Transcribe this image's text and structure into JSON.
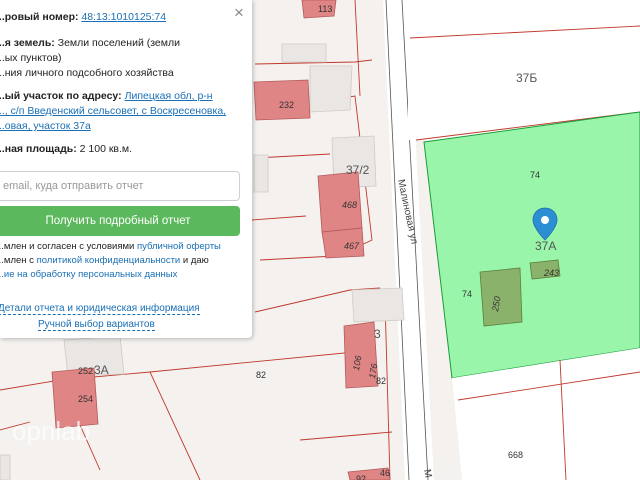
{
  "map": {
    "parcels": [
      "113",
      "232",
      "37/2",
      "468",
      "467",
      "37Б",
      "74",
      "74",
      "37А",
      "243",
      "74",
      "250",
      "106",
      "176",
      "82",
      "3",
      "82",
      "252",
      "254",
      "3А",
      "668",
      "46",
      "92"
    ],
    "street_name": "Малиновая ул",
    "street_name_bottom": "М",
    "watermark": "opnlab",
    "marker_icon": "map-pin-icon",
    "colors": {
      "selected_parcel": "#99f5aa",
      "building": "#e08585",
      "selected_building": "#8ab26b",
      "boundary": "#c0392b",
      "marker": "#2c8fd4"
    }
  },
  "panel": {
    "cadastral_label": "...ровый номер:",
    "cadastral_value": "48:13:1010125:74",
    "land_category_label": "...я земель:",
    "land_category_line1": "Земли поселений (земли",
    "land_category_line2": "...ых пунктов)",
    "land_use_line": "...ния личного подсобного хозяйства",
    "address_label": "...ый участок по адресу:",
    "address_line1": "Липецкая обл, р-н",
    "address_line2": "..., с/п Введенский сельсовет, с Воскресеновка,",
    "address_line3": "...овая, участок 37а",
    "area_label": "...ная площадь:",
    "area_value": "2 100 кв.м.",
    "email_placeholder": "email, куда отправить отчет",
    "report_button": "Получить подробный отчет",
    "terms_line1_text": "...млен и согласен с условиями ",
    "terms_line1_link": "публичной оферты",
    "terms_line2_text": "...млен с ",
    "terms_line2_link": "политикой конфиденциальности",
    "terms_line2_tail": " и даю",
    "terms_line3_link": "...ие на обработку персональных данных",
    "details_link": "Детали отчета и юридическая информация",
    "manual_link": "Ручной выбор вариантов",
    "close_icon": "close-icon"
  }
}
